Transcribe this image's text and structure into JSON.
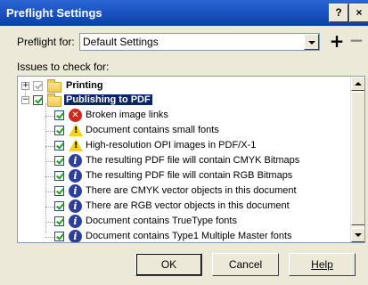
{
  "window": {
    "title": "Preflight Settings"
  },
  "titlebar_buttons": {
    "help": "?",
    "close": "×"
  },
  "preflight_for": {
    "label": "Preflight for:",
    "value": "Default Settings"
  },
  "profile_buttons": {
    "add": "+",
    "remove": "−"
  },
  "issues_label": "Issues to check for:",
  "tree": {
    "printing": {
      "label": "Printing",
      "checked": true
    },
    "publishing": {
      "label": "Publishing to PDF",
      "checked": true
    },
    "items": [
      {
        "label": "Broken image links",
        "icon": "error-icon"
      },
      {
        "label": "Document contains small fonts",
        "icon": "warning-icon"
      },
      {
        "label": "High-resolution OPI images in PDF/X-1",
        "icon": "warning-icon"
      },
      {
        "label": "The resulting PDF file will contain CMYK Bitmaps",
        "icon": "info-icon"
      },
      {
        "label": "The resulting PDF file will contain RGB Bitmaps",
        "icon": "info-icon"
      },
      {
        "label": "There are CMYK vector objects in this document",
        "icon": "info-icon"
      },
      {
        "label": "There are RGB vector objects in this document",
        "icon": "info-icon"
      },
      {
        "label": "Document contains TrueType fonts",
        "icon": "info-icon"
      },
      {
        "label": "Document contains Type1 Multiple Master fonts",
        "icon": "info-icon"
      }
    ]
  },
  "buttons": {
    "ok": "OK",
    "cancel": "Cancel",
    "help": "Help"
  },
  "colors": {
    "titlebar": "#0b3fa8",
    "selection": "#0a246a",
    "error": "#d6261b",
    "warning": "#f6d21c",
    "info": "#2d3f9b"
  }
}
